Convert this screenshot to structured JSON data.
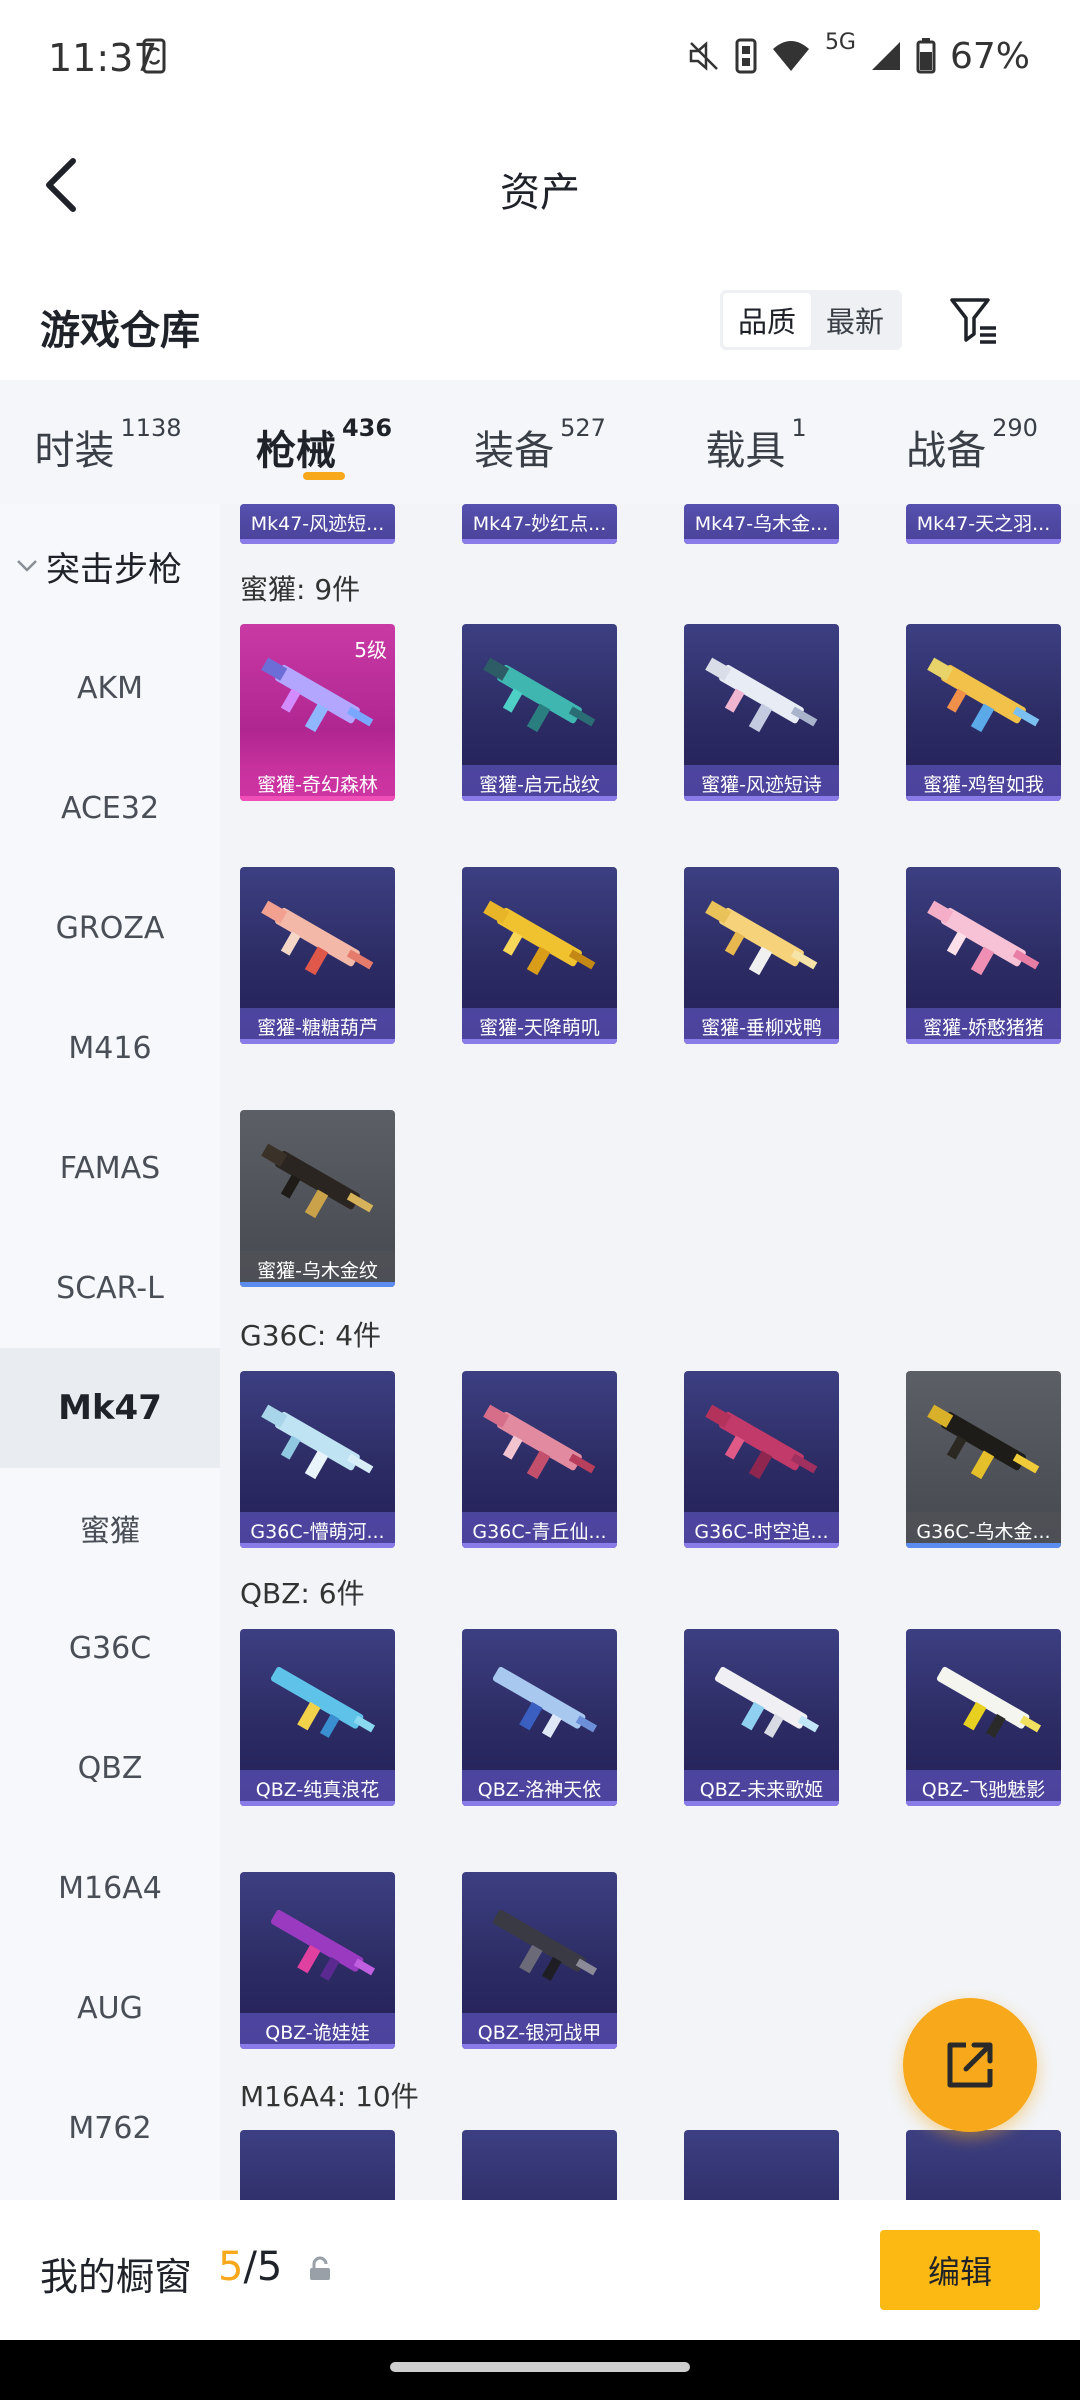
{
  "status": {
    "time": "11:37",
    "battery": "67%",
    "network": "5G"
  },
  "header": {
    "title": "资产"
  },
  "section": {
    "title": "游戏仓库",
    "sort_options": [
      "品质",
      "最新"
    ]
  },
  "tabs": [
    {
      "label": "时装",
      "count": "1138"
    },
    {
      "label": "枪械",
      "count": "436"
    },
    {
      "label": "装备",
      "count": "527"
    },
    {
      "label": "载具",
      "count": "1"
    },
    {
      "label": "战备",
      "count": "290"
    }
  ],
  "sidebar": {
    "group": "突击步枪",
    "items": [
      "AKM",
      "ACE32",
      "GROZA",
      "M416",
      "FAMAS",
      "SCAR-L",
      "Mk47",
      "蜜獾",
      "G36C",
      "QBZ",
      "M16A4",
      "AUG",
      "M762"
    ]
  },
  "content": {
    "top_row": [
      "Mk47-风迹短...",
      "Mk47-妙红点...",
      "Mk47-乌木金...",
      "Mk47-天之羽..."
    ],
    "groups": [
      {
        "title": "蜜獾: 9件",
        "items": [
          {
            "name": "蜜獾-奇幻森林",
            "level": "5级",
            "style": "pink"
          },
          {
            "name": "蜜獾-启元战纹",
            "style": "purple"
          },
          {
            "name": "蜜獾-风迹短诗",
            "style": "purple"
          },
          {
            "name": "蜜獾-鸡智如我",
            "style": "purple"
          },
          {
            "name": "蜜獾-糖糖葫芦",
            "style": "purple"
          },
          {
            "name": "蜜獾-天降萌叽",
            "style": "purple"
          },
          {
            "name": "蜜獾-垂柳戏鸭",
            "style": "purple"
          },
          {
            "name": "蜜獾-娇憨猪猪",
            "style": "purple"
          },
          {
            "name": "蜜獾-乌木金纹",
            "style": "grey"
          }
        ]
      },
      {
        "title": "G36C: 4件",
        "items": [
          {
            "name": "G36C-懵萌河...",
            "style": "purple"
          },
          {
            "name": "G36C-青丘仙...",
            "style": "purple"
          },
          {
            "name": "G36C-时空追...",
            "style": "purple"
          },
          {
            "name": "G36C-乌木金...",
            "style": "grey"
          }
        ]
      },
      {
        "title": "QBZ: 6件",
        "items": [
          {
            "name": "QBZ-纯真浪花",
            "style": "purple"
          },
          {
            "name": "QBZ-洛神天依",
            "style": "purple"
          },
          {
            "name": "QBZ-未来歌姬",
            "style": "purple"
          },
          {
            "name": "QBZ-飞驰魅影",
            "style": "purple"
          },
          {
            "name": "QBZ-诡娃娃",
            "style": "purple"
          },
          {
            "name": "QBZ-银河战甲",
            "style": "purple"
          }
        ]
      },
      {
        "title": "M16A4: 10件"
      }
    ]
  },
  "bottom": {
    "label": "我的橱窗",
    "current": "5",
    "total": "/5",
    "edit": "编辑"
  },
  "colors": {
    "accent": "#f7a81b",
    "card_purple": "#2c2b63",
    "card_pink": "#b02691",
    "card_grey": "#45484e"
  }
}
